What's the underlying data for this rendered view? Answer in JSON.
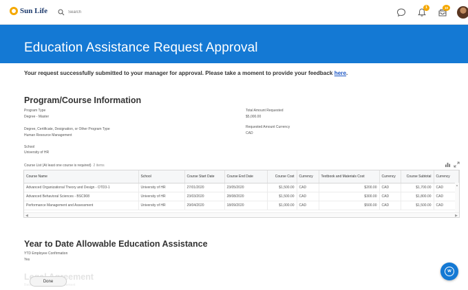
{
  "header": {
    "logo_text": "Sun Life",
    "search_placeholder": "Search",
    "notifications_count": "1",
    "inbox_count": "10"
  },
  "banner": {
    "title": "Education Assistance Request Approval"
  },
  "notice": {
    "text": "Your request successfully submitted to your manager for approval. Please take a moment to provide your feedback ",
    "link": "here",
    "end": "."
  },
  "program": {
    "section_title": "Program/Course Information",
    "program_type_label": "Program Type",
    "program_type_value": "Degree - Master",
    "degree_label": "Degree, Certificate, Designation, or Other Program Type",
    "degree_value": "Human Resource Management",
    "school_label": "School",
    "school_value": "University of HR",
    "total_label": "Total Amount Requested",
    "total_value": "$5,000.00",
    "currency_label": "Requested Amount Currency",
    "currency_value": "CAD"
  },
  "course_list": {
    "label": "Course List (At least one course is required)",
    "count": "2 items",
    "columns": [
      "Course Name",
      "School",
      "Course Start Date",
      "Course End Date",
      "Course Cost",
      "Currency",
      "Textbook and Materials Cost",
      "Currency",
      "Course Subtotal",
      "Currency"
    ],
    "rows": [
      [
        "Advanced Organizational Theory and Design - OTD3-1",
        "University of HR",
        "27/01/2020",
        "23/05/2020",
        "$1,500.00",
        "CAD",
        "$200.00",
        "CAD",
        "$1,700.00",
        "CAD"
      ],
      [
        "Advanced Behavioral Sciences - BSC908",
        "University of HR",
        "23/03/2020",
        "28/08/2020",
        "$1,500.00",
        "CAD",
        "$300.00",
        "CAD",
        "$1,800.00",
        "CAD"
      ],
      [
        "Performance Management and Assessment",
        "University of HR",
        "29/04/2020",
        "18/09/2020",
        "$1,000.00",
        "CAD",
        "$500.00",
        "CAD",
        "$1,500.00",
        "CAD"
      ]
    ]
  },
  "ytd": {
    "section_title": "Year to Date Allowable Education Assistance",
    "confirmation_label": "YTD Employee Confirmation",
    "confirmation_value": "Yes"
  },
  "legal": {
    "section_title": "Legal Agreement",
    "sub_label": "Reimbursement Legal Agreement"
  },
  "footer": {
    "done_label": "Done"
  },
  "colors": {
    "brand_blue": "#1479d4",
    "accent_yellow": "#f5a800",
    "link_blue": "#1a55c4"
  }
}
